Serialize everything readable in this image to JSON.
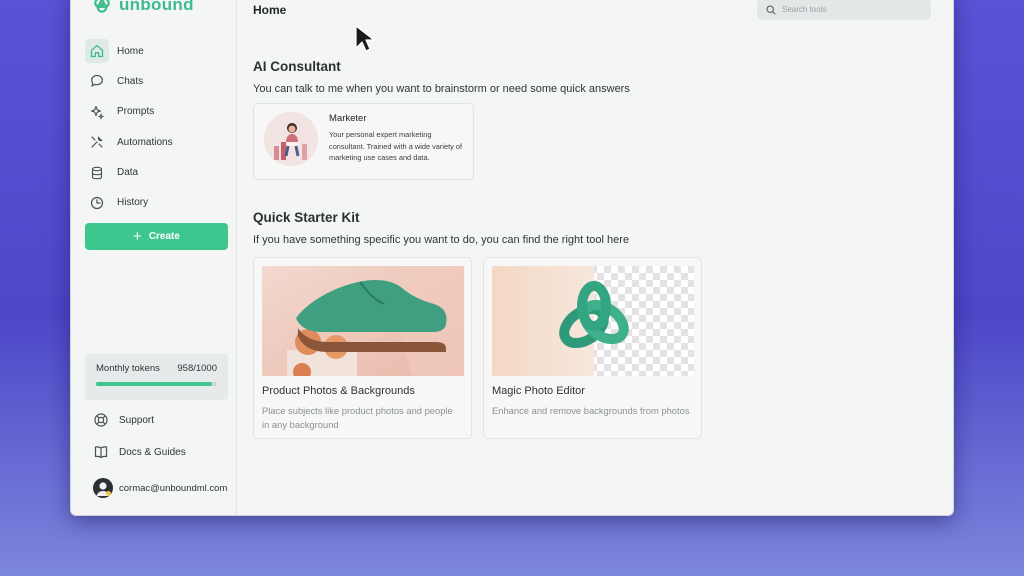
{
  "app": {
    "name": "unbound",
    "accent": "#3ec68f"
  },
  "sidebar": {
    "items": [
      {
        "label": "Home",
        "icon": "home-icon",
        "active": true
      },
      {
        "label": "Chats",
        "icon": "chat-icon"
      },
      {
        "label": "Prompts",
        "icon": "sparkle-icon"
      },
      {
        "label": "Automations",
        "icon": "tools-icon"
      },
      {
        "label": "Data",
        "icon": "database-icon"
      },
      {
        "label": "History",
        "icon": "history-icon"
      }
    ],
    "create_label": "Create",
    "tokens": {
      "label": "Monthly tokens",
      "value": "958/1000",
      "fraction": 0.958
    },
    "support_label": "Support",
    "docs_label": "Docs & Guides",
    "user_email": "cormac@unboundml.com"
  },
  "header": {
    "title": "Home",
    "search_placeholder": "Search tools"
  },
  "consultant": {
    "section_title": "AI Consultant",
    "section_subtitle": "You can talk to me when you want to brainstorm or need some quick answers",
    "card": {
      "name": "Marketer",
      "description": "Your personal expert marketing consultant. Trained with a wide variety of marketing use cases and data."
    }
  },
  "starter": {
    "section_title": "Quick Starter Kit",
    "section_subtitle": "If you have something specific you want to do, you can find the right tool here",
    "tools": [
      {
        "title": "Product Photos & Backgrounds",
        "description": "Place subjects like product photos and people in any background"
      },
      {
        "title": "Magic Photo Editor",
        "description": "Enhance and remove backgrounds from photos"
      }
    ]
  }
}
